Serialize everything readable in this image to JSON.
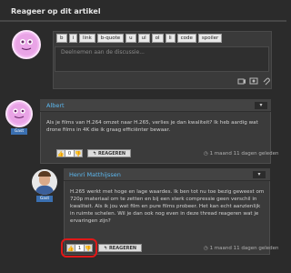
{
  "section": {
    "title": "Reageer op dit artikel"
  },
  "compose": {
    "toolbar": [
      "b",
      "i",
      "link",
      "b-quote",
      "u",
      "ul",
      "ol",
      "li",
      "code",
      "spoiler"
    ],
    "placeholder": "Deelnemen aan de discussie...",
    "icons": [
      "camera-icon",
      "image-icon",
      "attach-icon"
    ]
  },
  "comments": [
    {
      "author": "Albert",
      "badge": "Gast",
      "text": "Als je films van H.264 omzet naar H.265, verlies je dan kwaliteit? Ik heb aardig wat drone films in 4K die ik graag efficiënter bewaar.",
      "votes": "0",
      "reply_label": "REAGEREN",
      "time": "1 maand 11 dagen geleden"
    },
    {
      "author": "Henri Matthijssen",
      "badge": "Gast",
      "text": "H.265 werkt met hoge en lage waardes. Ik ben tot nu toe bezig geweest om 720p materiaal om te zetten en bij een sterk compressie geen verschil in kwaliteit. Als ik jou wat film en pure films probeer. Het kan echt aanzienlijk in ruimte schelen. Wil je dan ook nog even in deze thread reageren wat je ervaringen zijn?",
      "votes": "1",
      "reply_label": "REAGEREN",
      "time": "1 maand 11 dagen geleden"
    }
  ],
  "colors": {
    "background": "#2b2b2b",
    "name": "#5cb8f0",
    "badge": "#3a6fb0",
    "highlight": "#e01818"
  }
}
